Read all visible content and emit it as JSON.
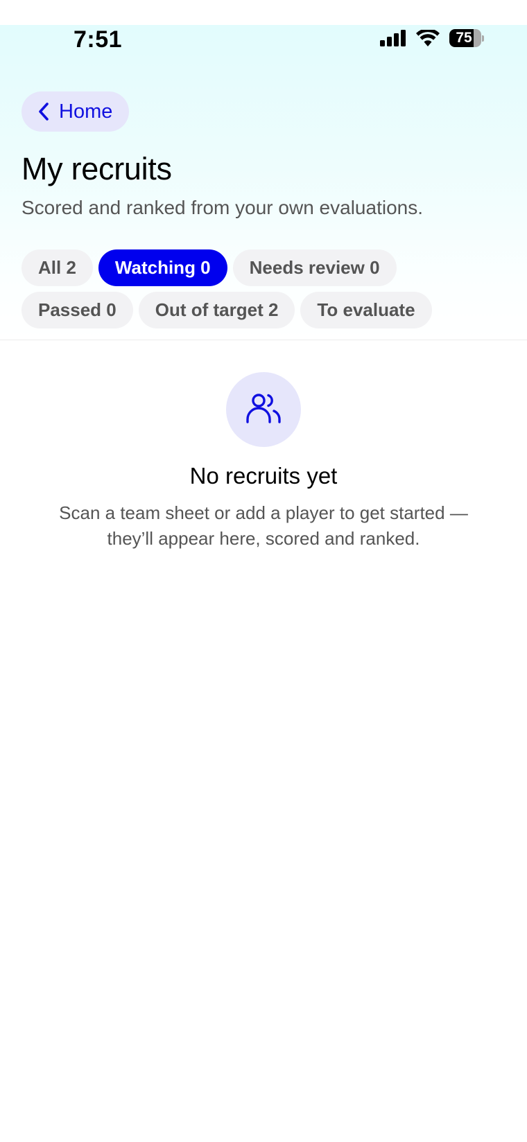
{
  "status_bar": {
    "time": "7:51",
    "battery_level": "75",
    "icons": [
      "signal-icon",
      "wifi-icon",
      "battery-icon"
    ]
  },
  "nav": {
    "back_label": "Home",
    "back_icon": "chevron-left-icon"
  },
  "header": {
    "title": "My recruits",
    "subtitle": "Scored and ranked from your own evaluations."
  },
  "filters": {
    "row1": [
      {
        "label": "All 2",
        "active": false
      },
      {
        "label": "Watching 0",
        "active": true
      },
      {
        "label": "Needs review 0",
        "active": false
      }
    ],
    "row2": [
      {
        "label": "Passed 0",
        "active": false
      },
      {
        "label": "Out of target 2",
        "active": false
      },
      {
        "label": "To evaluate",
        "active": false
      }
    ]
  },
  "empty_state": {
    "icon": "users-icon",
    "title": "No recruits yet",
    "message": "Scan a team sheet or add a player to get started — they’ll appear here, scored and ranked."
  },
  "colors": {
    "accent": "#0000EE",
    "accent_soft": "#E6E6FB",
    "chip_bg": "#F2F2F4",
    "header_gradient_top": "#E2FCFD"
  }
}
